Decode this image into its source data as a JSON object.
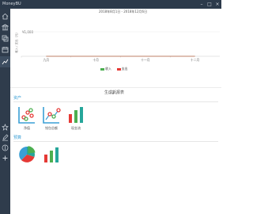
{
  "window": {
    "title": "MoneyBU"
  },
  "sidebar": {
    "items": [
      {
        "icon": "home-icon"
      },
      {
        "icon": "bank-icon"
      },
      {
        "icon": "copy-icon"
      },
      {
        "icon": "calendar-icon"
      },
      {
        "icon": "chart-icon"
      },
      {
        "icon": "star-icon"
      },
      {
        "icon": "edit-icon"
      },
      {
        "icon": "dollar-icon"
      },
      {
        "icon": "plus-icon"
      }
    ]
  },
  "chart_data": {
    "type": "line",
    "title": "2018年8月1日 - 2018年12月6日",
    "ylabel": "收入 / 支出（元）",
    "y_tick": "¥1,000",
    "categories": [
      "九月",
      "十月",
      "十一月",
      "十二月"
    ],
    "series": [
      {
        "name": "收入",
        "color": "#4caf50",
        "values": [
          0,
          0,
          0,
          0
        ]
      },
      {
        "name": "支出",
        "color": "#e53935",
        "values": [
          0,
          0,
          0,
          0
        ]
      }
    ]
  },
  "pager": {
    "count": 3,
    "active": 1
  },
  "report_section": {
    "title": "生成新报表"
  },
  "categories": [
    {
      "label": "资产",
      "tiles": [
        {
          "icon": "scatter-chart-icon",
          "label": "净值"
        },
        {
          "icon": "line-trend-icon",
          "label": "钱包总额"
        },
        {
          "icon": "bar-chart-icon",
          "label": "现金流"
        }
      ]
    },
    {
      "label": "预算",
      "tiles": [
        {
          "icon": "pie-chart-icon",
          "label": ""
        },
        {
          "icon": "bar-chart-icon",
          "label": ""
        }
      ]
    }
  ],
  "colors": {
    "accent": "#3a9fd5",
    "income": "#4caf50",
    "expense": "#e53935",
    "teal": "#26a69a",
    "sidebar": "#2f3c4c"
  }
}
